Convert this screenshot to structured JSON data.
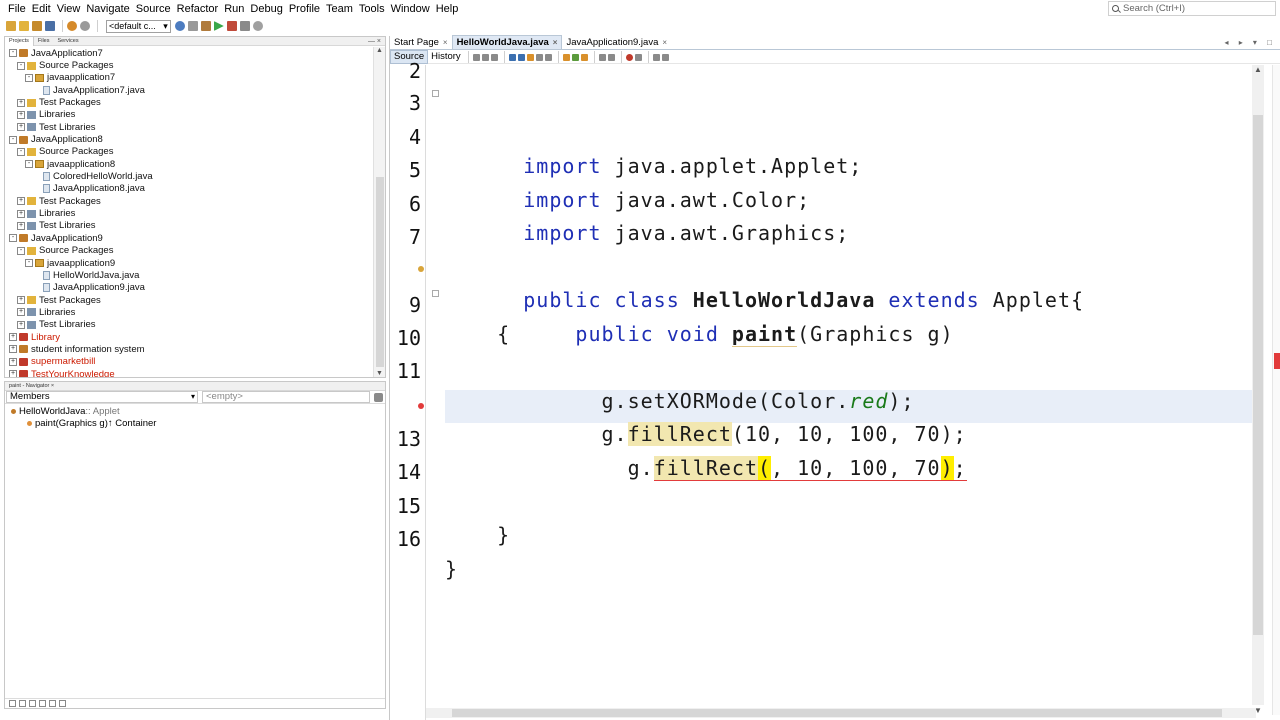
{
  "menu": [
    "File",
    "Edit",
    "View",
    "Navigate",
    "Source",
    "Refactor",
    "Run",
    "Debug",
    "Profile",
    "Team",
    "Tools",
    "Window",
    "Help"
  ],
  "search_placeholder": "Search (Ctrl+I)",
  "toolbar": {
    "config": "<default c..."
  },
  "projects_panel": {
    "tabs": [
      "Projects",
      "Files",
      "Services"
    ],
    "controls": "— ×",
    "tree": [
      {
        "label": "JavaApplication7",
        "level": 0,
        "icon": "project-icon",
        "exp": "-"
      },
      {
        "label": "Source Packages",
        "level": 1,
        "icon": "source-packages-icon",
        "exp": "-"
      },
      {
        "label": "javaapplication7",
        "level": 2,
        "icon": "package-icon",
        "exp": "-"
      },
      {
        "label": "JavaApplication7.java",
        "level": 3,
        "icon": "java-file-icon",
        "exp": ""
      },
      {
        "label": "Test Packages",
        "level": 1,
        "icon": "source-packages-icon",
        "exp": "+"
      },
      {
        "label": "Libraries",
        "level": 1,
        "icon": "libraries-icon",
        "exp": "+"
      },
      {
        "label": "Test Libraries",
        "level": 1,
        "icon": "libraries-icon",
        "exp": "+"
      },
      {
        "label": "JavaApplication8",
        "level": 0,
        "icon": "project-icon",
        "exp": "-"
      },
      {
        "label": "Source Packages",
        "level": 1,
        "icon": "source-packages-icon",
        "exp": "-"
      },
      {
        "label": "javaapplication8",
        "level": 2,
        "icon": "package-icon",
        "exp": "-"
      },
      {
        "label": "ColoredHelloWorld.java",
        "level": 3,
        "icon": "java-file-icon",
        "exp": ""
      },
      {
        "label": "JavaApplication8.java",
        "level": 3,
        "icon": "java-file-icon",
        "exp": ""
      },
      {
        "label": "Test Packages",
        "level": 1,
        "icon": "source-packages-icon",
        "exp": "+"
      },
      {
        "label": "Libraries",
        "level": 1,
        "icon": "libraries-icon",
        "exp": "+"
      },
      {
        "label": "Test Libraries",
        "level": 1,
        "icon": "libraries-icon",
        "exp": "+"
      },
      {
        "label": "JavaApplication9",
        "level": 0,
        "icon": "project-icon",
        "exp": "-"
      },
      {
        "label": "Source Packages",
        "level": 1,
        "icon": "source-packages-icon",
        "exp": "-"
      },
      {
        "label": "javaapplication9",
        "level": 2,
        "icon": "package-icon",
        "exp": "-"
      },
      {
        "label": "HelloWorldJava.java",
        "level": 3,
        "icon": "java-file-icon",
        "exp": ""
      },
      {
        "label": "JavaApplication9.java",
        "level": 3,
        "icon": "java-file-icon",
        "exp": ""
      },
      {
        "label": "Test Packages",
        "level": 1,
        "icon": "source-packages-icon",
        "exp": "+"
      },
      {
        "label": "Libraries",
        "level": 1,
        "icon": "libraries-icon",
        "exp": "+"
      },
      {
        "label": "Test Libraries",
        "level": 1,
        "icon": "libraries-icon",
        "exp": "+"
      },
      {
        "label": "Library",
        "level": 0,
        "icon": "project-error-icon",
        "exp": "+",
        "error": true
      },
      {
        "label": "student information system",
        "level": 0,
        "icon": "project-icon",
        "exp": "+"
      },
      {
        "label": "supermarketbill",
        "level": 0,
        "icon": "project-error-icon",
        "exp": "+",
        "error": true
      },
      {
        "label": "TestYourKnowledge",
        "level": 0,
        "icon": "project-error-icon",
        "exp": "+",
        "error": true
      }
    ]
  },
  "navigator": {
    "tab": "paint - Navigator ×",
    "members": "Members",
    "filter": "<empty>",
    "items": [
      {
        "name": "HelloWorldJava",
        "suffix": " :: Applet",
        "level": 0,
        "color": "#c07a28"
      },
      {
        "name": "paint(Graphics g)",
        "suffix": " ↑ Container",
        "level": 1,
        "color": "#e0903a"
      }
    ]
  },
  "editor": {
    "tabs": [
      {
        "label": "Start Page",
        "active": false
      },
      {
        "label": "HelloWorldJava.java",
        "active": true
      },
      {
        "label": "JavaApplication9.java",
        "active": false
      }
    ],
    "tab_controls": "◂ ▸ ▾ □",
    "source_tab": "Source",
    "history_tab": "History",
    "line_numbers": [
      "2",
      "3",
      "4",
      "5",
      "6",
      "7",
      "9",
      "10",
      "11",
      "13",
      "14",
      "15",
      "16"
    ],
    "code": {
      "l3_kw": "import",
      "l3_rest": " java.applet.Applet;",
      "l4_kw": "import",
      "l4_rest": " java.awt.Color;",
      "l5_kw": "import",
      "l5_rest": " java.awt.Graphics;",
      "l7_kw1": "public",
      "l7_kw2": " class ",
      "l7_cls": "HelloWorldJava",
      "l7_kw3": " extends ",
      "l7_rest": "Applet{",
      "l8_indent": "    ",
      "l8_kw1": "public",
      "l8_kw2": " void ",
      "l8_method": "paint",
      "l8_rest": "(Graphics g)",
      "l9": "    {",
      "l10_pre": "      g.setXORMode(Color.",
      "l10_it": "red",
      "l10_post": ");",
      "l11_pre": "      g.",
      "l11_hl": "fillRect",
      "l11_post": "(10, 10, 100, 70);",
      "l12_pre": "        g.",
      "l12_hl": "fillRect",
      "l12_open": "(",
      "l12_mid": ", 10, 100, 70",
      "l12_close": ")",
      "l12_end": ";",
      "l15": "    }",
      "l16": "}"
    }
  }
}
